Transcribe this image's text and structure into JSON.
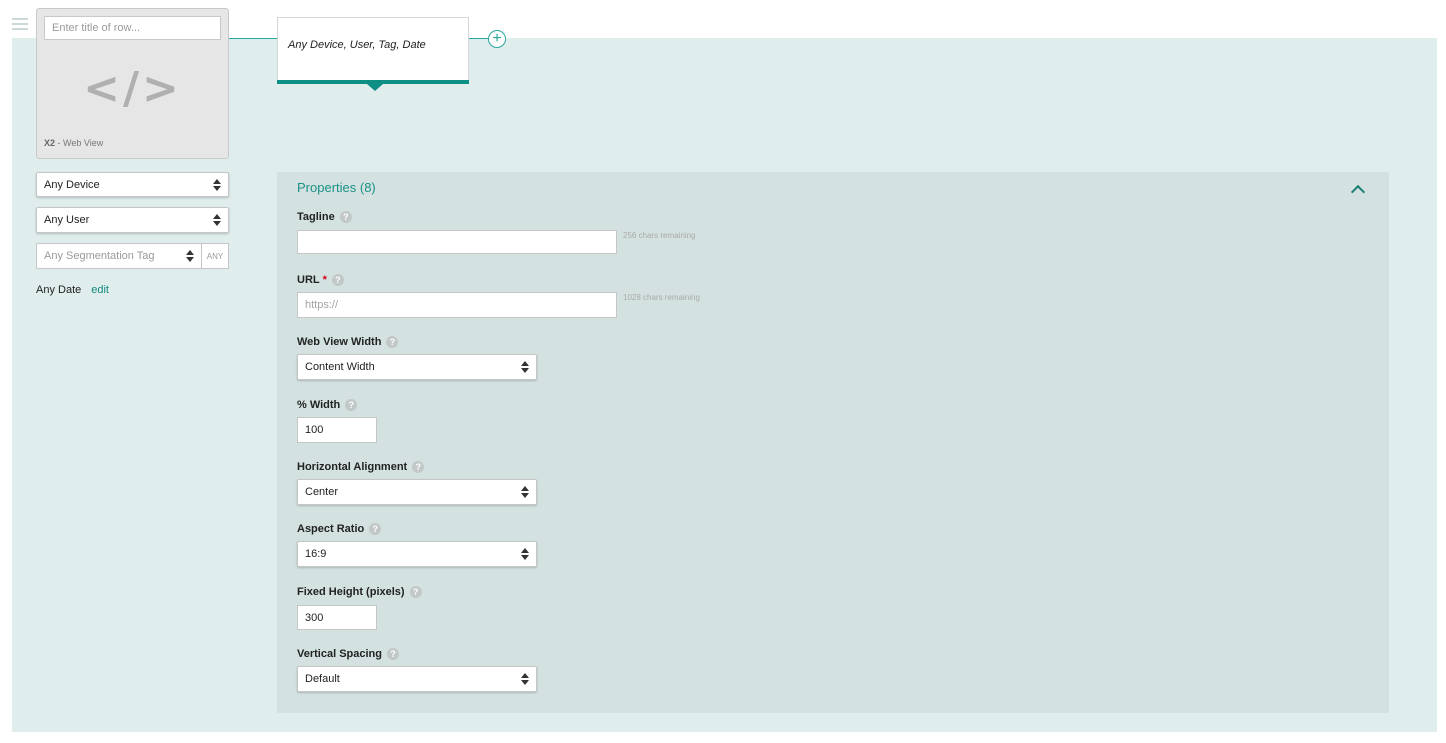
{
  "row": {
    "title_placeholder": "Enter title of row...",
    "code_glyph": "</>",
    "caption_bold": "X2",
    "caption_rest": " - Web View"
  },
  "filters": {
    "device": "Any Device",
    "user": "Any User",
    "segmentation_placeholder": "Any Segmentation Tag",
    "any_button": "ANY",
    "date_label": "Any Date",
    "date_edit": "edit"
  },
  "tab": {
    "label": "Any Device, User, Tag, Date"
  },
  "add_icon": "+",
  "properties": {
    "title": "Properties (8)",
    "help_glyph": "?",
    "required_marker": "*",
    "tagline": {
      "label": "Tagline",
      "value": "",
      "remaining": "256 chars remaining"
    },
    "url": {
      "label": "URL",
      "placeholder": "https://",
      "remaining": "1028 chars remaining"
    },
    "web_view_width": {
      "label": "Web View Width",
      "value": "Content Width"
    },
    "percent_width": {
      "label": "% Width",
      "value": "100"
    },
    "horizontal_alignment": {
      "label": "Horizontal Alignment",
      "value": "Center"
    },
    "aspect_ratio": {
      "label": "Aspect Ratio",
      "value": "16:9"
    },
    "fixed_height": {
      "label": "Fixed Height (pixels)",
      "value": "300"
    },
    "vertical_spacing": {
      "label": "Vertical Spacing",
      "value": "Default"
    }
  },
  "icons": {
    "menu": "hamburger-icon",
    "collapse": "chevron-up-icon",
    "select": "updown-arrows-icon",
    "help": "question-icon",
    "add": "plus-circle-icon",
    "code": "code-icon"
  },
  "colors": {
    "accent": "#0e8f84",
    "area_bg": "#dfeded",
    "panel_bg": "#d3e2e1",
    "required": "#d0021b"
  }
}
